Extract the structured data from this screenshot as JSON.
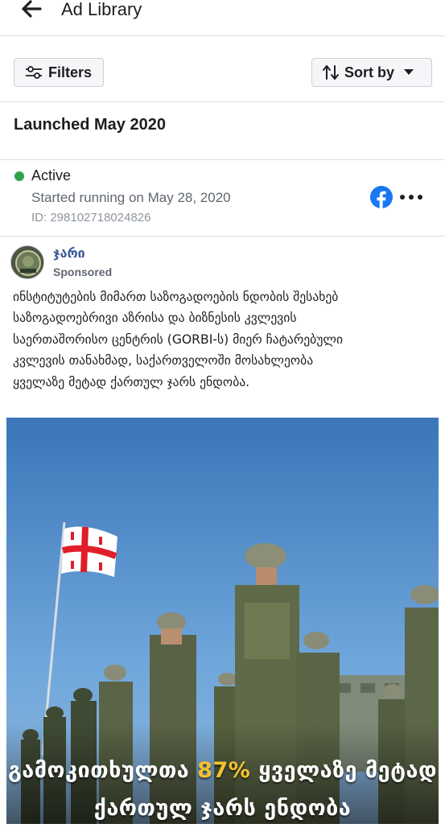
{
  "header": {
    "title": "Ad Library",
    "back_icon": "arrow-left-icon"
  },
  "toolbar": {
    "filters_label": "Filters",
    "filters_icon": "sliders-icon",
    "sort_label": "Sort by",
    "sort_icon": "sort-arrows-icon",
    "sort_caret_icon": "caret-down-icon"
  },
  "section": {
    "title": "Launched May 2020"
  },
  "ad": {
    "status": "Active",
    "status_color": "#31a24c",
    "started": "Started running on May 28, 2020",
    "id": "ID: 298102718024826",
    "platform_icon": "facebook-icon",
    "more_icon": "more-horizontal-icon",
    "page_name": "ჯარი",
    "sponsored": "Sponsored",
    "body": "ინსტიტუტების მიმართ საზოგადოების ნდობის შესახებ\nსაზოგადოებრივი აზრისა და ბიზნესის კვლევის\nსაერთაშორისო ცენტრის (GORBI-ს) მიერ ჩატარებული\nკვლევის თანახმად, საქართველოში მოსახლეობა\nყველაზე მეტად ქართულ ჯარს ენდობა.",
    "creative": {
      "headline_before": "გამოკითხულთა ",
      "headline_percent": "87%",
      "headline_after": " ყველაზე მეტად",
      "headline_line2": "ქართულ ჯარს ენდობა",
      "accent_color": "#f2c230"
    }
  }
}
